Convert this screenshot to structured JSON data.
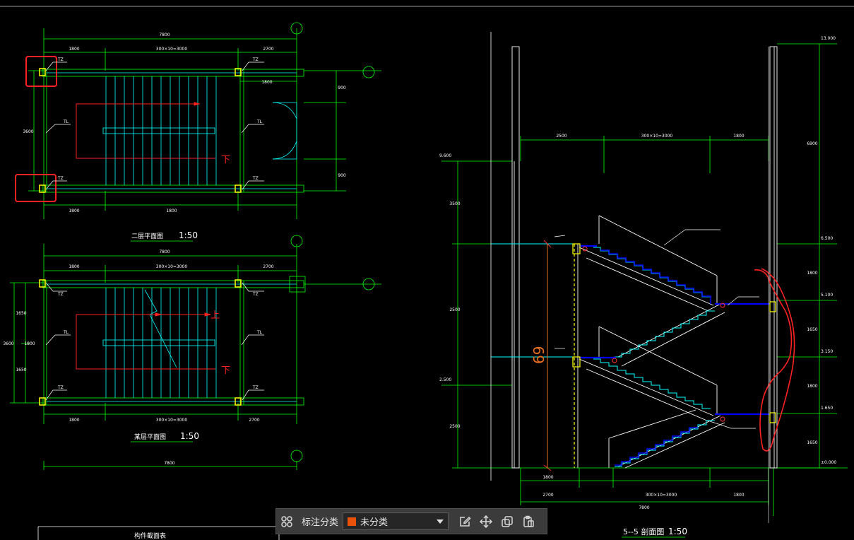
{
  "drawing": {
    "plan_top": {
      "dims": [
        "7800",
        "1800",
        "300×10=3000",
        "2700",
        "1800",
        "1800",
        "1800",
        "900",
        "900",
        "3600"
      ],
      "labels": [
        "TZ",
        "TZ",
        "TL",
        "TL",
        "TZ",
        "TZ",
        "下"
      ],
      "title": "二层平面图",
      "scale": "1:50"
    },
    "plan_bottom": {
      "dims": [
        "7800",
        "1800",
        "300×10=3000",
        "2700",
        "1800",
        "300×10=3000",
        "2700",
        "1650",
        "1800",
        "1650",
        "3600"
      ],
      "labels": [
        "TZ",
        "TZ",
        "TL",
        "TL",
        "TZ",
        "TZ",
        "上",
        "下"
      ],
      "title": "某层平面图",
      "scale": "1:50",
      "bottom_dim": "7800"
    },
    "section": {
      "levels": [
        "13.000",
        "9.600",
        "6.500",
        "5.100",
        "3.150",
        "2.500",
        "1.650",
        "±0.000"
      ],
      "side_dims": [
        "3500",
        "2500",
        "2500",
        "6900",
        "1800",
        "1650",
        "1800",
        "1650"
      ],
      "top_dims": [
        "2500",
        "300×10=3000",
        "1800"
      ],
      "bottom_dims": [
        "1800",
        "2700",
        "300×10=3000",
        "1800",
        "7800"
      ],
      "handwritten": "69",
      "title": "5--5 剖面图",
      "scale": "1:50"
    },
    "table_title": "构件截面表"
  },
  "toolbar": {
    "label": "标注分类",
    "select_value": "未分类",
    "swatch_color": "#e8520a"
  },
  "colors": {
    "wall": "#00ff00",
    "stair": "#00ffff",
    "column": "#ffff00",
    "arrow": "#ff2020",
    "mark": "#ff2222",
    "slab": "#0000ff",
    "white": "#ffffff"
  }
}
